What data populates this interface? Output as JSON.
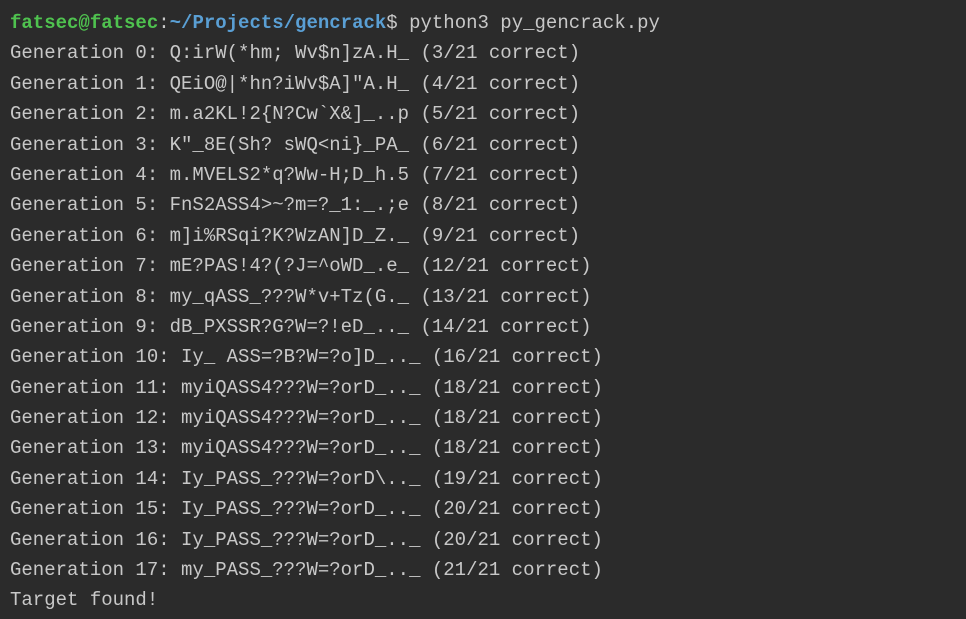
{
  "prompt": {
    "user_host": "fatsec@fatsec",
    "colon": ":",
    "path": "~/Projects/gencrack",
    "dollar": "$ ",
    "command": "python3 py_gencrack.py"
  },
  "lines": [
    "Generation 0: Q:irW(*hm; Wv$n]zA.H_ (3/21 correct)",
    "Generation 1: QEiO@|*hn?iWv$A]\"A.H_ (4/21 correct)",
    "Generation 2: m.a2KL!2{N?Cw`X&]_..p (5/21 correct)",
    "Generation 3: K\"_8E(Sh? sWQ<ni}_PA_ (6/21 correct)",
    "Generation 4: m.MVELS2*q?Ww-H;D_h.5 (7/21 correct)",
    "Generation 5: FnS2ASS4>~?m=?_1:_.;e (8/21 correct)",
    "Generation 6: m]i%RSqi?K?WzAN]D_Z._ (9/21 correct)",
    "Generation 7: mE?PAS!4?(?J=^oWD_.e_ (12/21 correct)",
    "Generation 8: my_qASS_???W*v+Tz(G._ (13/21 correct)",
    "Generation 9: dB_PXSSR?G?W=?!eD_.._ (14/21 correct)",
    "Generation 10: Iy_ ASS=?B?W=?o]D_.._ (16/21 correct)",
    "Generation 11: myiQASS4???W=?orD_.._ (18/21 correct)",
    "Generation 12: myiQASS4???W=?orD_.._ (18/21 correct)",
    "Generation 13: myiQASS4???W=?orD_.._ (18/21 correct)",
    "Generation 14: Iy_PASS_???W=?orD\\.._ (19/21 correct)",
    "Generation 15: Iy_PASS_???W=?orD_.._ (20/21 correct)",
    "Generation 16: Iy_PASS_???W=?orD_.._ (20/21 correct)",
    "Generation 17: my_PASS_???W=?orD_.._ (21/21 correct)"
  ],
  "final": "Target found!"
}
